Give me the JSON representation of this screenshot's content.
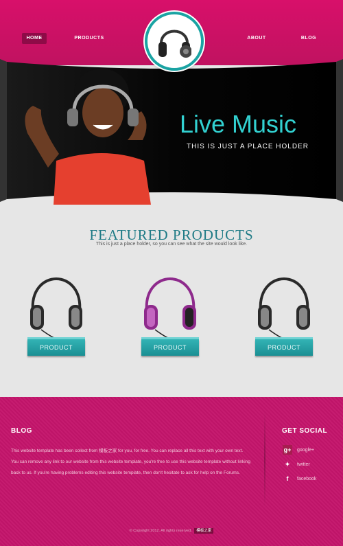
{
  "nav": {
    "home": "HOME",
    "products": "PRODUCTS",
    "about": "ABOUT",
    "blog": "BLOG"
  },
  "banner": {
    "title": "Live Music",
    "subtitle": "THIS IS JUST A PLACE HOLDER"
  },
  "featured": {
    "title": "FEATURED PRODUCTS",
    "subtitle": "This is just a place holder, so you can see what the site would look like.",
    "products": [
      {
        "label": "PRODUCT",
        "color": "#2a2a2a"
      },
      {
        "label": "PRODUCT",
        "color": "#8e2a8c"
      },
      {
        "label": "PRODUCT",
        "color": "#2a2a2a"
      }
    ]
  },
  "footer": {
    "blog_title": "BLOG",
    "blog_text": "This website template has been collect from 模板之家 for you, for free. You can replace all this text with your own text. You can remove any link to our website from this website template, you're free to use this website template without linking back to us. If you're having problems editing this website template, then don't hesitate to ask for help on the Forums.",
    "social_title": "GET SOCIAL",
    "social": [
      {
        "label": "google+",
        "icon": "google-plus-icon"
      },
      {
        "label": "twitter",
        "icon": "twitter-icon"
      },
      {
        "label": "facebook",
        "icon": "facebook-icon"
      }
    ],
    "copyright": "© Copyright 2012. All rights reserved.",
    "copyright_tag": "模板之家"
  },
  "colors": {
    "brand_pink": "#c4156b",
    "accent_teal": "#1aa3a3"
  }
}
